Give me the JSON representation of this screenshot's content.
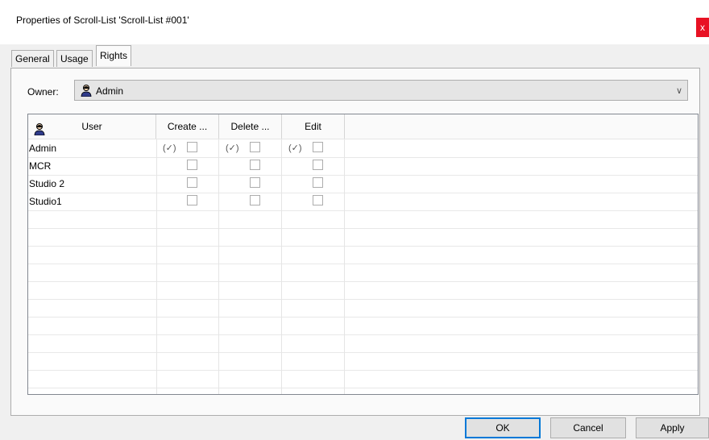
{
  "window": {
    "title": "Properties of Scroll-List 'Scroll-List #001'",
    "close_label": "x"
  },
  "tabs": [
    {
      "label": "General",
      "active": false
    },
    {
      "label": "Usage",
      "active": false
    },
    {
      "label": "Rights",
      "active": true
    }
  ],
  "owner": {
    "label": "Owner:",
    "value": "Admin",
    "icon": "person-icon"
  },
  "grid": {
    "columns": [
      "User",
      "Create ...",
      "Delete ...",
      "Edit"
    ],
    "header_icon": "person-icon",
    "rows": [
      {
        "user": "Admin",
        "create": {
          "checked": false,
          "inherited_mark": "(✓)"
        },
        "delete": {
          "checked": false,
          "inherited_mark": "(✓)"
        },
        "edit": {
          "checked": false,
          "inherited_mark": "(✓)"
        }
      },
      {
        "user": "MCR",
        "create": {
          "checked": false
        },
        "delete": {
          "checked": false
        },
        "edit": {
          "checked": false
        }
      },
      {
        "user": "Studio 2",
        "create": {
          "checked": false
        },
        "delete": {
          "checked": false
        },
        "edit": {
          "checked": false
        }
      },
      {
        "user": "Studio1",
        "create": {
          "checked": false
        },
        "delete": {
          "checked": false
        },
        "edit": {
          "checked": false
        }
      }
    ]
  },
  "buttons": {
    "ok": "OK",
    "cancel": "Cancel",
    "apply": "Apply"
  }
}
